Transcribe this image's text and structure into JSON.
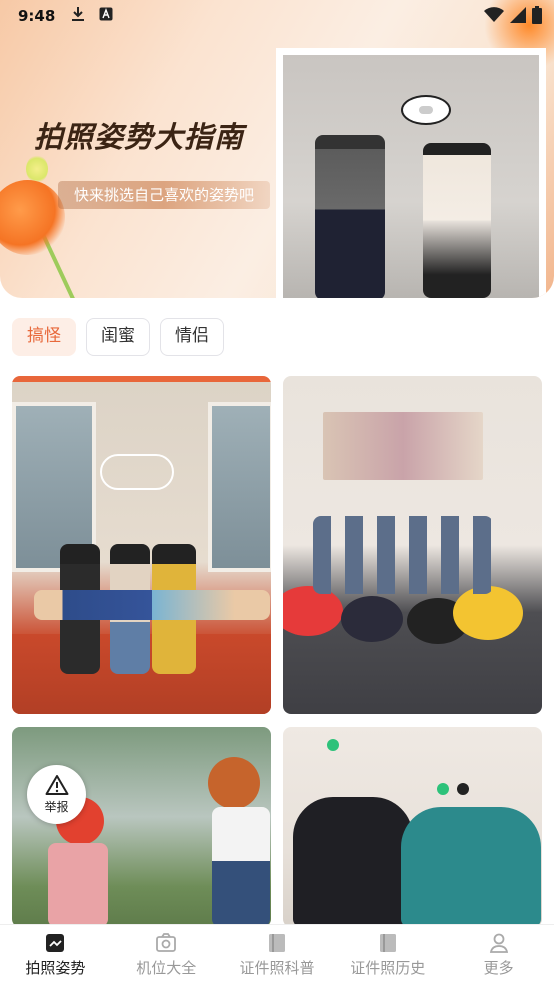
{
  "status_bar": {
    "time": "9:48",
    "left_icons": [
      "download-icon",
      "text-notification-icon"
    ],
    "right_icons": [
      "wifi-icon",
      "signal-icon",
      "battery-icon"
    ]
  },
  "banner": {
    "title": "拍照姿势大指南",
    "subtitle": "快来挑选自己喜欢的姿势吧"
  },
  "tabs": [
    {
      "label": "搞怪",
      "active": true
    },
    {
      "label": "闺蜜",
      "active": false
    },
    {
      "label": "情侣",
      "active": false
    }
  ],
  "grid": {
    "cards": [
      {
        "name": "pose-photo-1"
      },
      {
        "name": "pose-photo-2"
      },
      {
        "name": "pose-photo-3"
      },
      {
        "name": "pose-photo-4"
      }
    ]
  },
  "report_button": {
    "label": "举报",
    "icon": "warning-icon"
  },
  "bottom_nav": {
    "items": [
      {
        "label": "拍照姿势",
        "icon": "pose-icon",
        "active": true
      },
      {
        "label": "机位大全",
        "icon": "camera-icon",
        "active": false
      },
      {
        "label": "证件照科普",
        "icon": "book-icon",
        "active": false
      },
      {
        "label": "证件照历史",
        "icon": "book-icon",
        "active": false
      },
      {
        "label": "更多",
        "icon": "person-icon",
        "active": false
      }
    ]
  },
  "colors": {
    "accent": "#e8693b",
    "accent_bg": "#fdeee6"
  }
}
